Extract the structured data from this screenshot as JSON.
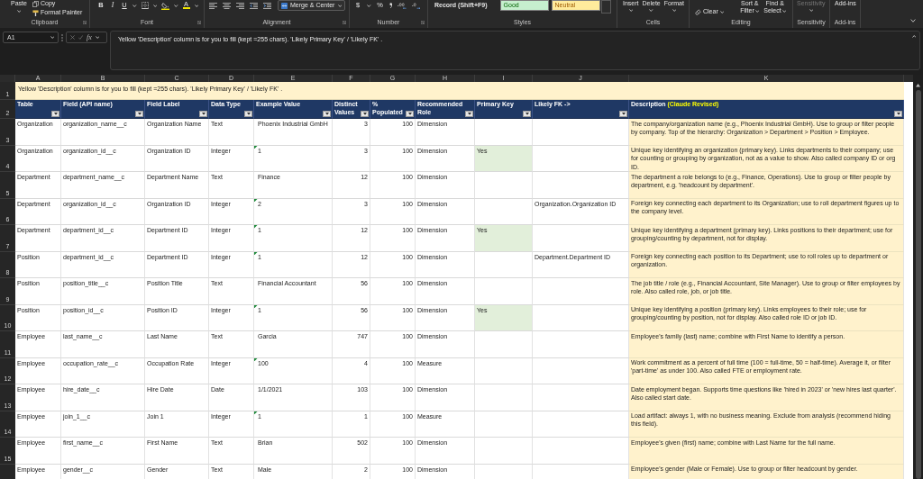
{
  "ribbon": {
    "clipboard": {
      "paste": "Paste",
      "copy": "Copy",
      "format_painter": "Format Painter",
      "label": "Clipboard"
    },
    "font": {
      "bold": "B",
      "italic": "I",
      "underline": "U",
      "font_color": "A",
      "label": "Font"
    },
    "alignment": {
      "merge": "Merge & Center",
      "label": "Alignment"
    },
    "number": {
      "currency": "$",
      "percent": "%",
      "label": "Number"
    },
    "styles": {
      "macro": "Record (Shift+F9)",
      "cell_styles": [
        {
          "label": "Good",
          "kind": "good"
        },
        {
          "label": "Neutral",
          "kind": "neutral"
        }
      ],
      "label": "Styles"
    },
    "cells": {
      "buttons": [
        "Insert",
        "Delete",
        "Format"
      ],
      "label": "Cells"
    },
    "editing": {
      "clear": "Clear",
      "buttons": [
        "Sort & Filter",
        "Find & Select"
      ],
      "label": "Editing"
    },
    "sensitivity": {
      "button": "Sensitivity",
      "disabled": true,
      "label": "Sensitivity"
    },
    "add_ins": {
      "button": "Add-ins",
      "label": "Add-ins"
    }
  },
  "formula_bar": {
    "name_box": "A1",
    "function_label": "fx",
    "content": "Yellow 'Description' column is for you to fill (kept =255 chars). 'Likely Primary Key' / 'Likely FK' ."
  },
  "sheet": {
    "column_letters": [
      "A",
      "B",
      "C",
      "D",
      "E",
      "F",
      "G",
      "H",
      "I",
      "J",
      "K"
    ],
    "note_row": {
      "number": "1",
      "text": "Yellow 'Description' column is for you to fill (kept =255 chars). 'Likely Primary Key' / 'Likely FK' ."
    },
    "header_row": {
      "number": "2",
      "columns": [
        {
          "label": "Table"
        },
        {
          "label": "Field (API name)"
        },
        {
          "label": "Field Label"
        },
        {
          "label": "Data Type"
        },
        {
          "label": "Example Value"
        },
        {
          "label": "Distinct Values"
        },
        {
          "label": "% Populated"
        },
        {
          "label": "Recommended Role"
        },
        {
          "label": "Primary Key"
        },
        {
          "label": "Likely FK ->"
        },
        {
          "label": "Description",
          "note": "(Claude Revised)"
        }
      ]
    },
    "rows": [
      {
        "number": "3",
        "table": "Organization",
        "field": "organization_name__c",
        "label": "Organization Name",
        "type": "Text",
        "example": "Phoenix Industrial GmbH",
        "flagged": false,
        "distinct": "3",
        "populated": "100",
        "role": "Dimension",
        "key_highlight": false,
        "description": "The company/organization name (e.g., Phoenix Industrial GmbH). Use to group or filter people by company. Top of the hierarchy: Organization > Department > Position > Employee."
      },
      {
        "number": "4",
        "table": "Organization",
        "field": "organization_id__c",
        "label": "Organization ID",
        "type": "Integer",
        "example": "1",
        "flagged": true,
        "distinct": "3",
        "populated": "100",
        "role": "Dimension",
        "primary_key": "Yes",
        "key_highlight": true,
        "description": "Unique key identifying an organization (primary key). Links departments to their company; use for counting or grouping by organization, not as a value to show. Also called company ID or org ID."
      },
      {
        "number": "5",
        "table": "Department",
        "field": "department_name__c",
        "label": "Department Name",
        "type": "Text",
        "example": "Finance",
        "flagged": false,
        "distinct": "12",
        "populated": "100",
        "role": "Dimension",
        "key_highlight": false,
        "description": "The department a role belongs to (e.g., Finance, Operations). Use to group or filter people by department, e.g. 'headcount by department'."
      },
      {
        "number": "6",
        "table": "Department",
        "field": "organization_id__c",
        "label": "Organization ID",
        "type": "Integer",
        "example": "2",
        "flagged": true,
        "distinct": "3",
        "populated": "100",
        "role": "Dimension",
        "key_highlight": false,
        "fk": "Organization.Organization ID",
        "description": "Foreign key connecting each department to its Organization; use to roll department figures up to the company level."
      },
      {
        "number": "7",
        "table": "Department",
        "field": "department_id__c",
        "label": "Department ID",
        "type": "Integer",
        "example": "1",
        "flagged": true,
        "distinct": "12",
        "populated": "100",
        "role": "Dimension",
        "primary_key": "Yes",
        "key_highlight": true,
        "description": "Unique key identifying a department (primary key). Links positions to their department; use for grouping/counting by department, not for display."
      },
      {
        "number": "8",
        "table": "Position",
        "field": "department_id__c",
        "label": "Department ID",
        "type": "Integer",
        "example": "1",
        "flagged": true,
        "distinct": "12",
        "populated": "100",
        "role": "Dimension",
        "key_highlight": false,
        "fk": "Department.Department ID",
        "description": "Foreign key connecting each position to its Department; use to roll roles up to department or organization."
      },
      {
        "number": "9",
        "table": "Position",
        "field": "position_title__c",
        "label": "Position Title",
        "type": "Text",
        "example": "Financial Accountant",
        "flagged": false,
        "distinct": "56",
        "populated": "100",
        "role": "Dimension",
        "key_highlight": false,
        "description": "The job title / role (e.g., Financial Accountant, Site Manager). Use to group or filter employees by role. Also called role, job, or job title."
      },
      {
        "number": "10",
        "table": "Position",
        "field": "position_id__c",
        "label": "Position ID",
        "type": "Integer",
        "example": "1",
        "flagged": true,
        "distinct": "56",
        "populated": "100",
        "role": "Dimension",
        "primary_key": "Yes",
        "key_highlight": true,
        "description": "Unique key identifying a position (primary key). Links employees to their role; use for grouping/counting by position, not for display. Also called role ID or job ID."
      },
      {
        "number": "11",
        "table": "Employee",
        "field": "last_name__c",
        "label": "Last Name",
        "type": "Text",
        "example": "Garcia",
        "flagged": false,
        "distinct": "747",
        "populated": "100",
        "role": "Dimension",
        "key_highlight": false,
        "description": "Employee's family (last) name; combine with First Name to identify a person."
      },
      {
        "number": "12",
        "table": "Employee",
        "field": "occupation_rate__c",
        "label": "Occupation Rate",
        "type": "Integer",
        "example": "100",
        "flagged": true,
        "distinct": "4",
        "populated": "100",
        "role": "Measure",
        "key_highlight": false,
        "description": "Work commitment as a percent of full time (100 = full-time, 50 = half-time). Average it, or filter 'part-time' as under 100. Also called FTE or employment rate."
      },
      {
        "number": "13",
        "table": "Employee",
        "field": "hire_date__c",
        "label": "Hire Date",
        "type": "Date",
        "example": "1/1/2021",
        "flagged": false,
        "distinct": "103",
        "populated": "100",
        "role": "Dimension",
        "key_highlight": false,
        "description": "Date employment began. Supports time questions like 'hired in 2023' or 'new hires last quarter'. Also called start date."
      },
      {
        "number": "14",
        "table": "Employee",
        "field": "join_1__c",
        "label": "Join 1",
        "type": "Integer",
        "example": "1",
        "flagged": true,
        "distinct": "1",
        "populated": "100",
        "role": "Measure",
        "key_highlight": false,
        "description": "Load artifact: always 1, with no business meaning. Exclude from analysis (recommend hiding this field)."
      },
      {
        "number": "15",
        "table": "Employee",
        "field": "first_name__c",
        "label": "First Name",
        "type": "Text",
        "example": "Brian",
        "flagged": false,
        "distinct": "502",
        "populated": "100",
        "role": "Dimension",
        "key_highlight": false,
        "description": "Employee's given (first) name; combine with Last Name for the full name."
      },
      {
        "table": "Employee",
        "field": "gender__c",
        "label": "Gender",
        "type": "Text",
        "example": "Male",
        "flagged": false,
        "distinct": "2",
        "populated": "100",
        "role": "Dimension",
        "key_highlight": false,
        "description": "Employee's gender (Male or Female). Use to group or filter headcount by gender."
      }
    ]
  }
}
